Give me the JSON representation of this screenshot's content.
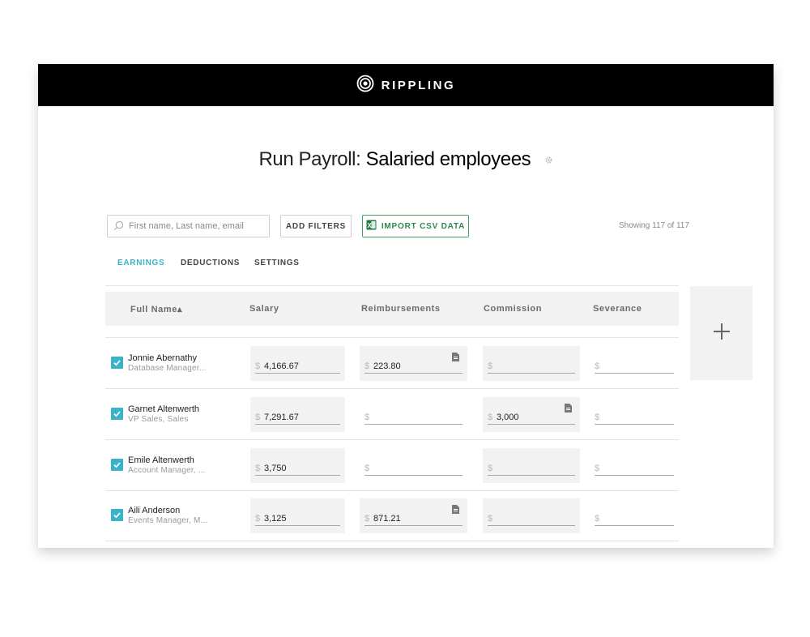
{
  "brand": {
    "name": "RIPPLING"
  },
  "page": {
    "title_prefix": "Run Payroll:",
    "title_main": "Salaried employees"
  },
  "toolbar": {
    "search_placeholder": "First name, Last name, email",
    "add_filters_label": "ADD FILTERS",
    "import_label": "IMPORT CSV DATA",
    "showing_text": "Showing 117 of 117"
  },
  "tabs": [
    {
      "label": "EARNINGS",
      "active": true
    },
    {
      "label": "DEDUCTIONS",
      "active": false
    },
    {
      "label": "SETTINGS",
      "active": false
    }
  ],
  "table": {
    "columns": [
      "Full Name▴",
      "Salary",
      "Reimbursements",
      "Commission",
      "Severance"
    ],
    "currency_symbol": "$",
    "rows": [
      {
        "name": "Jonnie Abernathy",
        "sub": "Database Manager...",
        "checked": true,
        "salary": "4,166.67",
        "reimbursements": "223.80",
        "commission": "",
        "severance": ""
      },
      {
        "name": "Garnet Altenwerth",
        "sub": "VP Sales, Sales",
        "checked": true,
        "salary": "7,291.67",
        "reimbursements": "",
        "commission": "3,000",
        "severance": ""
      },
      {
        "name": "Emile Altenwerth",
        "sub": "Account Manager, ...",
        "checked": true,
        "salary": "3,750",
        "reimbursements": "",
        "commission": "",
        "severance": ""
      },
      {
        "name": "Aili Anderson",
        "sub": "Events Manager, M...",
        "checked": true,
        "salary": "3,125",
        "reimbursements": "871.21",
        "commission": "",
        "severance": ""
      }
    ]
  },
  "add_column": {
    "symbol": "+"
  },
  "colors": {
    "accent": "#3ab3c9",
    "import_green": "#41a364",
    "topbar": "#000000"
  }
}
